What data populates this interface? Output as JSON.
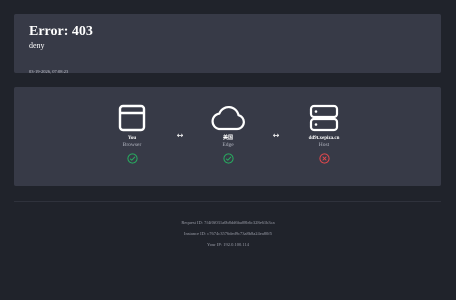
{
  "error": {
    "title": "Error: 403",
    "subtitle": "deny",
    "timestamp": "03-19-2026, 07:08:23"
  },
  "nodes": [
    {
      "name": "You",
      "role": "Browser",
      "icon": "browser-window-icon",
      "status": "ok",
      "status_icon": "check-circle-icon"
    },
    {
      "name": "美国",
      "role": "Edge",
      "icon": "cloud-icon",
      "status": "ok",
      "status_icon": "check-circle-icon"
    },
    {
      "name": "dd9t.xepiza.cn",
      "role": "Host",
      "icon": "server-icon",
      "status": "error",
      "status_icon": "x-circle-icon"
    }
  ],
  "connectors": [
    "↔",
    "↔"
  ],
  "colors": {
    "background": "#20232b",
    "panel": "#373a47",
    "ok": "#27ae60",
    "error": "#e5484d",
    "text": "#ffffff",
    "muted": "#9a9da8"
  },
  "footer": {
    "request_id_label": "Request ID: 7f4f0f031a0b8dd6ba08b6c328e61b3ca",
    "instance_id_label": "Instance ID: c7674c3576ded9c73a8b8a24ea80f5",
    "ip_label": "Your IP: 192.0.100.114"
  }
}
